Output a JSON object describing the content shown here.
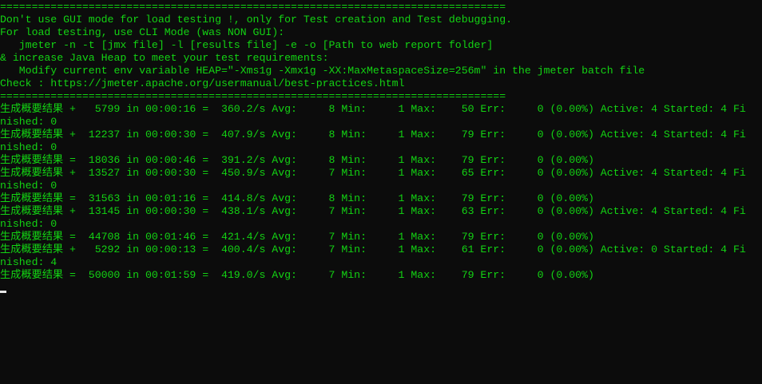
{
  "terminal": {
    "text_color": "#13d313",
    "background_color": "#0c0c0c",
    "lines": [
      "================================================================================",
      "Don't use GUI mode for load testing !, only for Test creation and Test debugging.",
      "For load testing, use CLI Mode (was NON GUI):",
      "   jmeter -n -t [jmx file] -l [results file] -e -o [Path to web report folder]",
      "& increase Java Heap to meet your test requirements:",
      "   Modify current env variable HEAP=\"-Xms1g -Xmx1g -XX:MaxMetaspaceSize=256m\" in the jmeter batch file",
      "Check : https://jmeter.apache.org/usermanual/best-practices.html",
      "================================================================================",
      "生成概要结果 +   5799 in 00:00:16 =  360.2/s Avg:     8 Min:     1 Max:    50 Err:     0 (0.00%) Active: 4 Started: 4 Fi",
      "nished: 0",
      "生成概要结果 +  12237 in 00:00:30 =  407.9/s Avg:     8 Min:     1 Max:    79 Err:     0 (0.00%) Active: 4 Started: 4 Fi",
      "nished: 0",
      "生成概要结果 =  18036 in 00:00:46 =  391.2/s Avg:     8 Min:     1 Max:    79 Err:     0 (0.00%)",
      "生成概要结果 +  13527 in 00:00:30 =  450.9/s Avg:     7 Min:     1 Max:    65 Err:     0 (0.00%) Active: 4 Started: 4 Fi",
      "nished: 0",
      "生成概要结果 =  31563 in 00:01:16 =  414.8/s Avg:     8 Min:     1 Max:    79 Err:     0 (0.00%)",
      "生成概要结果 +  13145 in 00:00:30 =  438.1/s Avg:     7 Min:     1 Max:    63 Err:     0 (0.00%) Active: 4 Started: 4 Fi",
      "nished: 0",
      "生成概要结果 =  44708 in 00:01:46 =  421.4/s Avg:     7 Min:     1 Max:    79 Err:     0 (0.00%)",
      "生成概要结果 +   5292 in 00:00:13 =  400.4/s Avg:     7 Min:     1 Max:    61 Err:     0 (0.00%) Active: 0 Started: 4 Fi",
      "nished: 4",
      "生成概要结果 =  50000 in 00:01:59 =  419.0/s Avg:     7 Min:     1 Max:    79 Err:     0 (0.00%)"
    ]
  }
}
